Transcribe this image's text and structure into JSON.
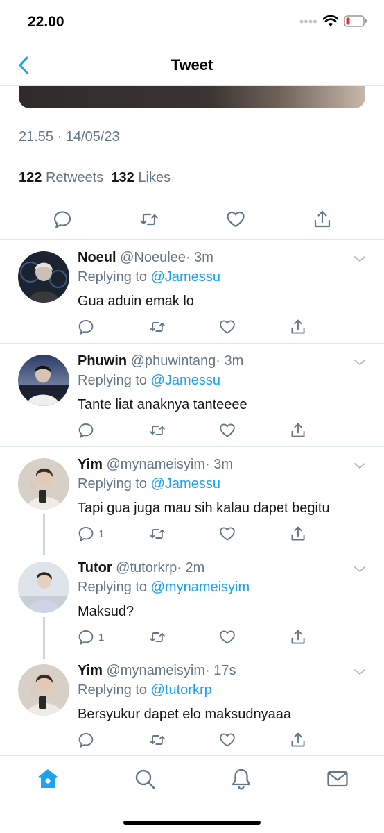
{
  "status_bar": {
    "time": "22.00"
  },
  "nav": {
    "title": "Tweet"
  },
  "tweet": {
    "time": "21.55 · 14/05/23",
    "retweets_count": "122",
    "retweets_label": "Retweets",
    "likes_count": "132",
    "likes_label": "Likes"
  },
  "replies": [
    {
      "name": "Noeul",
      "handle": "@Noeulee",
      "time": "· 3m",
      "replying_label": "Replying to",
      "replying_to": "@Jamessu",
      "text": "Gua aduin emak lo",
      "reply_count": ""
    },
    {
      "name": "Phuwin",
      "handle": "@phuwintang",
      "time": "· 3m",
      "replying_label": "Replying to",
      "replying_to": "@Jamessu",
      "text": "Tante liat anaknya tanteeee",
      "reply_count": ""
    },
    {
      "name": "Yim",
      "handle": "@mynameisyim",
      "time": "· 3m",
      "replying_label": "Replying to",
      "replying_to": "@Jamessu",
      "text": "Tapi gua juga mau sih kalau dapet begitu",
      "reply_count": "1"
    },
    {
      "name": "Tutor",
      "handle": "@tutorkrp",
      "time": "· 2m",
      "replying_label": "Replying to",
      "replying_to": "@mynameisyim",
      "text": "Maksud?",
      "reply_count": "1"
    },
    {
      "name": "Yim",
      "handle": "@mynameisyim",
      "time": "· 17s",
      "replying_label": "Replying to",
      "replying_to": "@tutorkrp",
      "text": "Bersyukur dapet elo maksudnyaaa",
      "reply_count": ""
    }
  ],
  "tabs": [
    {
      "icon": "home-icon",
      "active": true
    },
    {
      "icon": "search-icon",
      "active": false
    },
    {
      "icon": "bell-icon",
      "active": false
    },
    {
      "icon": "mail-icon",
      "active": false
    }
  ],
  "colors": {
    "accent": "#1da1f2",
    "muted": "#657786",
    "text": "#14171a",
    "divider": "#e1e8ed"
  }
}
